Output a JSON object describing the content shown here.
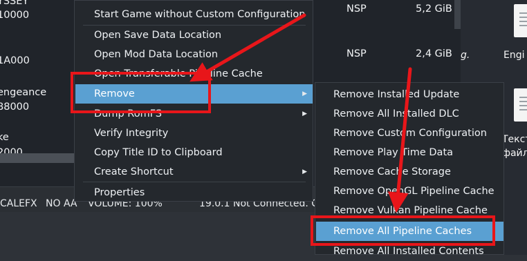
{
  "game_list": {
    "rows": [
      {
        "title": "YSSEY",
        "sub": "10000",
        "type": "NSP",
        "size": "5,2 GiB"
      },
      {
        "title": "",
        "sub": "1A000",
        "type": "NSP",
        "size": "2,4 GiB"
      },
      {
        "title": "engeance",
        "sub": "88000",
        "type": "",
        "size": ""
      },
      {
        "title": "ke",
        "sub": "2000",
        "type": "",
        "size": ""
      }
    ]
  },
  "status_bar": {
    "filter": "CALEFX",
    "aa": "NO AA",
    "volume": "VOLUME: 100%",
    "version": "19.0.1",
    "network": "Not Connected. C"
  },
  "desktop": {
    "icon1_label": "Engi",
    "icon1_prefix": "g.",
    "icon2_label_line1": "Текст",
    "icon2_label_line2": "файл"
  },
  "context_menu": {
    "items": [
      {
        "label": "Start Game without Custom Configuration"
      },
      {
        "label": "Open Save Data Location"
      },
      {
        "label": "Open Mod Data Location"
      },
      {
        "label": "Open Transferable Pipeline Cache"
      },
      {
        "label": "Remove"
      },
      {
        "label": "Dump RomFS"
      },
      {
        "label": "Verify Integrity"
      },
      {
        "label": "Copy Title ID to Clipboard"
      },
      {
        "label": "Create Shortcut"
      },
      {
        "label": "Properties"
      }
    ]
  },
  "remove_submenu": {
    "items": [
      {
        "label": "Remove Installed Update"
      },
      {
        "label": "Remove All Installed DLC"
      },
      {
        "label": "Remove Custom Configuration"
      },
      {
        "label": "Remove Play Time Data"
      },
      {
        "label": "Remove Cache Storage"
      },
      {
        "label": "Remove OpenGL Pipeline Cache"
      },
      {
        "label": "Remove Vulkan Pipeline Cache"
      },
      {
        "label": "Remove All Pipeline Caches"
      },
      {
        "label": "Remove All Installed Contents"
      }
    ]
  },
  "colors": {
    "highlight": "#5aa0d2",
    "annotation_red": "#e8161a",
    "menu_bg": "#24282d"
  }
}
